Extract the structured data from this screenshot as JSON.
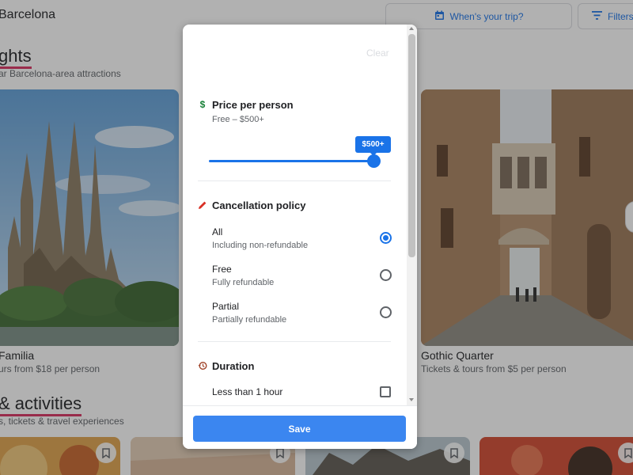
{
  "header": {
    "city_title": "Barcelona",
    "trip_button": "When's your trip?",
    "filters_button": "Filters"
  },
  "sights": {
    "heading": "ghts",
    "subheading": "ar Barcelona-area attractions",
    "cards": [
      {
        "title": "Familia",
        "subtitle": "urs from $18 per person"
      },
      {
        "title": "Gothic Quarter",
        "subtitle": "Tickets & tours from $5 per person"
      }
    ]
  },
  "activities": {
    "heading": "& activities",
    "subheading": "s, tickets & travel experiences"
  },
  "filter_modal": {
    "clear_label": "Clear",
    "price": {
      "title": "Price per person",
      "range_text": "Free – $500+",
      "badge": "$500+",
      "slider_fraction": 1.0
    },
    "cancellation": {
      "title": "Cancellation policy",
      "options": [
        {
          "title": "All",
          "subtitle": "Including non-refundable",
          "selected": true
        },
        {
          "title": "Free",
          "subtitle": "Fully refundable",
          "selected": false
        },
        {
          "title": "Partial",
          "subtitle": "Partially refundable",
          "selected": false
        }
      ]
    },
    "duration": {
      "title": "Duration",
      "options": [
        {
          "title": "Less than 1 hour",
          "checked": false
        }
      ]
    },
    "save_label": "Save"
  },
  "colors": {
    "accent": "#1a73e8",
    "save_button": "#3b86f0",
    "price_icon": "#188038",
    "cancel_icon": "#d93025",
    "duration_icon": "#a1442a",
    "heading_underline": "#d93060"
  },
  "icons": {
    "trip": "calendar-icon",
    "filters": "filter-lines-icon",
    "price": "dollar-icon",
    "cancellation": "pencil-icon",
    "duration": "history-icon",
    "bookmark": "bookmark-icon"
  }
}
